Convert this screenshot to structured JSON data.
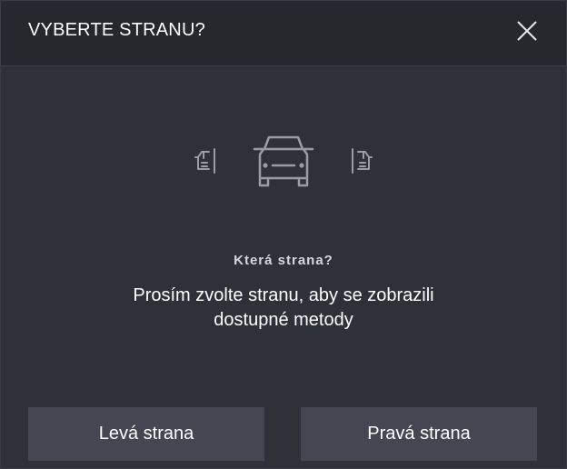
{
  "dialog": {
    "title": "VYBERTE STRANU?",
    "close_icon": "close-icon",
    "icons": [
      "car-left-side-icon",
      "car-front-icon",
      "car-right-side-icon"
    ],
    "question": "Která strana?",
    "description_line1": "Prosím zvolte stranu, aby se zobrazili",
    "description_line2": "dostupné metody",
    "left_button": "Levá strana",
    "right_button": "Pravá strana"
  },
  "colors": {
    "background": "#2f3139",
    "header": "#26282e",
    "button": "#444752",
    "icon": "#9a9ca3",
    "text": "#ffffff"
  }
}
